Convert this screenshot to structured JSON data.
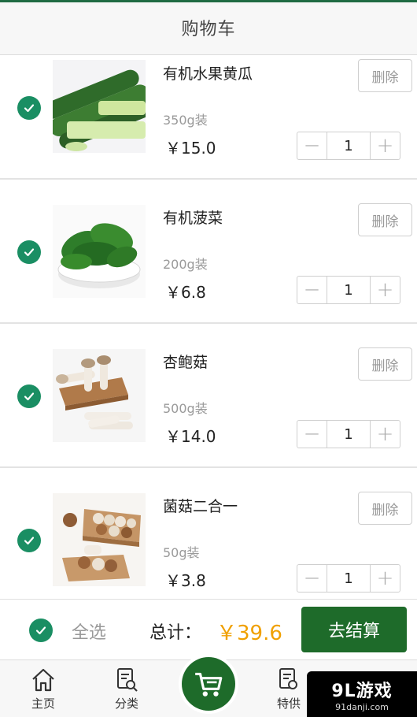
{
  "header": {
    "title": "购物车"
  },
  "items": [
    {
      "name": "有机水果黄瓜",
      "spec": "350g装",
      "price": "￥15.0",
      "qty": "1",
      "delete_label": "删除",
      "checked": true,
      "image": "cucumber"
    },
    {
      "name": "有机菠菜",
      "spec": "200g装",
      "price": "￥6.8",
      "qty": "1",
      "delete_label": "删除",
      "checked": true,
      "image": "spinach"
    },
    {
      "name": "杏鲍菇",
      "spec": "500g装",
      "price": "￥14.0",
      "qty": "1",
      "delete_label": "删除",
      "checked": true,
      "image": "king-oyster-mushroom"
    },
    {
      "name": "菌菇二合一",
      "spec": "50g装",
      "price": "￥3.8",
      "qty": "1",
      "delete_label": "删除",
      "checked": true,
      "image": "mushroom-mix"
    }
  ],
  "checkout": {
    "select_all": "全选",
    "total_label": "总计：",
    "total_value": "￥39.6",
    "pay_label": "去结算"
  },
  "tabs": [
    {
      "label": "主页",
      "icon": "home-icon"
    },
    {
      "label": "分类",
      "icon": "category-search-icon"
    },
    {
      "label": "",
      "icon": "cart-icon",
      "active": true
    },
    {
      "label": "特供",
      "icon": "special-doc-icon"
    }
  ],
  "watermark": {
    "main": "9L游戏",
    "sub": "91danji.com"
  },
  "colors": {
    "accent_green": "#1e6b2a",
    "check_green": "#1a8e63",
    "price_orange": "#f0a000"
  }
}
